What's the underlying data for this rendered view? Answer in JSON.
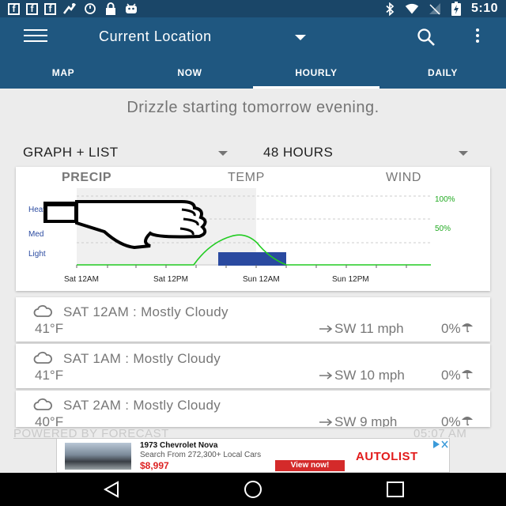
{
  "status_bar": {
    "time": "5:10",
    "icons_left": [
      "facebook-icon",
      "facebook-icon",
      "facebook-icon",
      "fitness-icon",
      "sync-icon",
      "lock-icon",
      "android-icon"
    ],
    "icons_right": [
      "bluetooth-icon",
      "wifi-icon",
      "no-signal-icon",
      "battery-charging-icon"
    ]
  },
  "app_bar": {
    "location": "Current Location",
    "tabs": [
      {
        "label": "MAP",
        "active": false
      },
      {
        "label": "NOW",
        "active": false
      },
      {
        "label": "HOURLY",
        "active": true
      },
      {
        "label": "DAILY",
        "active": false
      }
    ],
    "color": "#1f5780"
  },
  "summary": "Drizzle starting tomorrow evening.",
  "view_selector": "GRAPH + LIST",
  "range_selector": "48 HOURS",
  "graph": {
    "tabs": [
      "PRECIP",
      "TEMP",
      "WIND"
    ],
    "active_tab": "PRECIP",
    "y_labels": [
      "Heavy",
      "Med",
      "Light"
    ],
    "right_labels": [
      "100%",
      "50%"
    ],
    "x_labels": [
      "Sat 12AM",
      "Sat 12PM",
      "Sun 12AM",
      "Sun 12PM"
    ],
    "probability_color": "#22cc22",
    "intensity_color": "#2a4aa0",
    "overlay_icon": "thumbs-down-icon"
  },
  "hourly": [
    {
      "title": "SAT 12AM : Mostly Cloudy",
      "temp": "41°F",
      "wind": "SW 11 mph",
      "precip": "0%"
    },
    {
      "title": "SAT 1AM : Mostly Cloudy",
      "temp": "41°F",
      "wind": "SW 10 mph",
      "precip": "0%"
    },
    {
      "title": "SAT 2AM : Mostly Cloudy",
      "temp": "40°F",
      "wind": "SW 9 mph",
      "precip": "0%"
    }
  ],
  "footer": {
    "powered_by": "POWERED BY FORECAST",
    "update_time": "05:07 AM"
  },
  "ad": {
    "title": "1973 Chevrolet Nova",
    "subtitle": "Search From 272,300+ Local Cars",
    "price": "$8,997",
    "cta": "View now!",
    "brand": "AUTOLIST"
  },
  "nav": [
    "back-button",
    "home-button",
    "recents-button"
  ]
}
